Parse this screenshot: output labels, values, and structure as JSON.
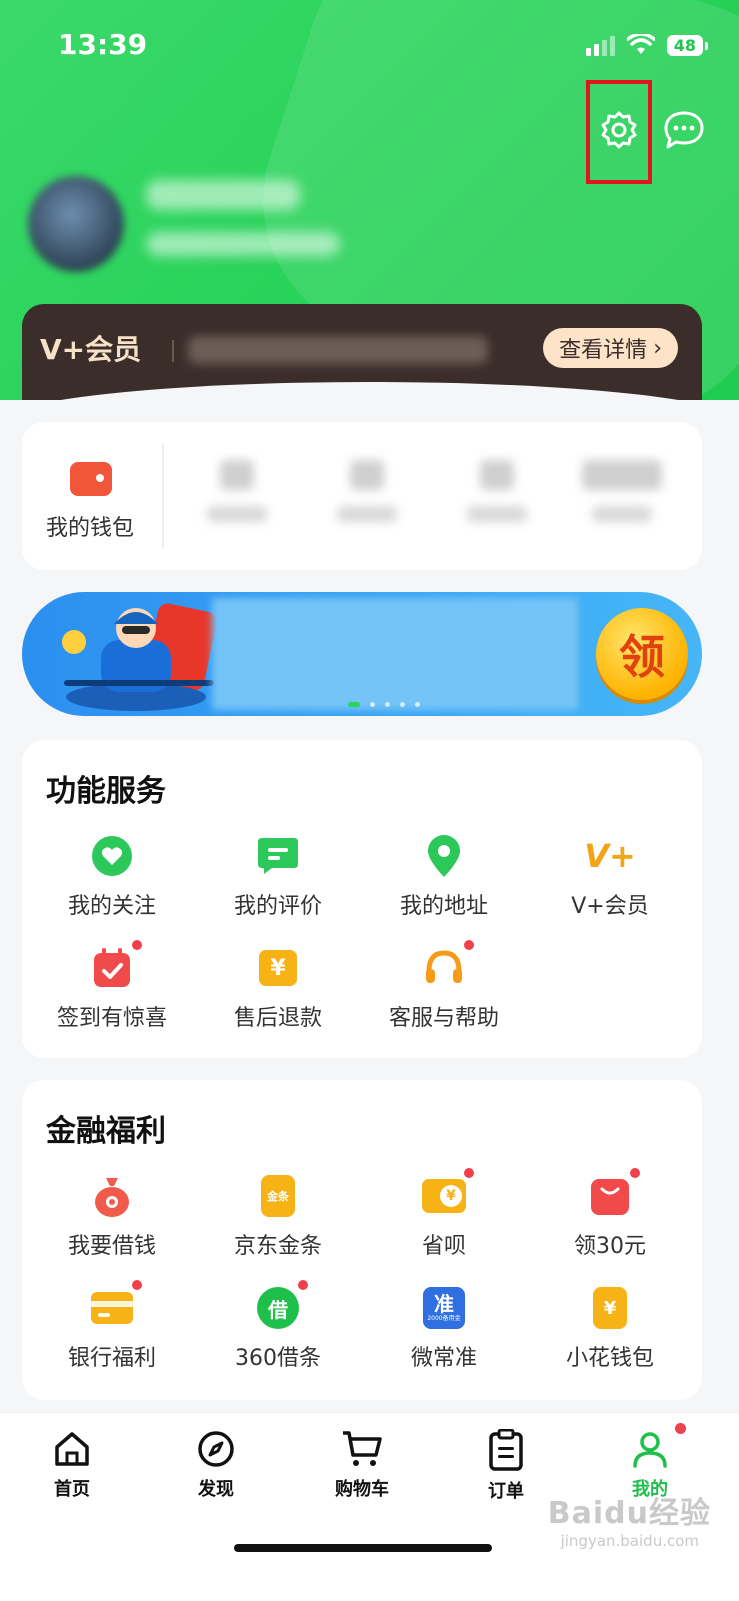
{
  "status_bar": {
    "time": "13:39",
    "battery": "48"
  },
  "header": {
    "settings_icon": "gear-icon",
    "message_icon": "chat-bubble-icon"
  },
  "member": {
    "logo": "V+会员",
    "details_label": "查看详情",
    "chevron": "›"
  },
  "wallet": {
    "label": "我的钱包"
  },
  "banner": {
    "claim_label": "领"
  },
  "services": {
    "title": "功能服务",
    "items": [
      {
        "label": "我的关注",
        "icon": "heart-icon"
      },
      {
        "label": "我的评价",
        "icon": "comment-icon"
      },
      {
        "label": "我的地址",
        "icon": "location-pin-icon"
      },
      {
        "label": "V+会员",
        "icon": "vplus-icon",
        "glyph": "V+"
      },
      {
        "label": "签到有惊喜",
        "icon": "calendar-check-icon"
      },
      {
        "label": "售后退款",
        "icon": "refund-icon",
        "glyph": "¥"
      },
      {
        "label": "客服与帮助",
        "icon": "headset-icon"
      }
    ]
  },
  "finance": {
    "title": "金融福利",
    "items": [
      {
        "label": "我要借钱",
        "icon": "money-bag-icon"
      },
      {
        "label": "京东金条",
        "icon": "gold-bar-icon",
        "glyph": "金条"
      },
      {
        "label": "省呗",
        "icon": "wallet-coin-icon",
        "glyph": "¥"
      },
      {
        "label": "领30元",
        "icon": "gift-bag-icon"
      },
      {
        "label": "银行福利",
        "icon": "bank-card-icon"
      },
      {
        "label": "360借条",
        "icon": "borrow-icon",
        "glyph": "借"
      },
      {
        "label": "微常准",
        "icon": "weichangzhun-icon",
        "glyph": "准",
        "sub": "2000备用金"
      },
      {
        "label": "小花钱包",
        "icon": "flower-wallet-icon",
        "glyph": "¥"
      }
    ]
  },
  "tabbar": {
    "items": [
      {
        "label": "首页",
        "icon": "home-icon"
      },
      {
        "label": "发现",
        "icon": "compass-icon"
      },
      {
        "label": "购物车",
        "icon": "cart-icon"
      },
      {
        "label": "订单",
        "icon": "order-list-icon"
      },
      {
        "label": "我的",
        "icon": "profile-icon"
      }
    ]
  },
  "watermark": {
    "text": "Baidu经验",
    "sub": "jingyan.baidu.com"
  },
  "colors": {
    "brand_green": "#2ad35b",
    "accent_red": "#e0161d",
    "vip_brown": "#3a2d2a",
    "badge_red": "#f0404b"
  }
}
